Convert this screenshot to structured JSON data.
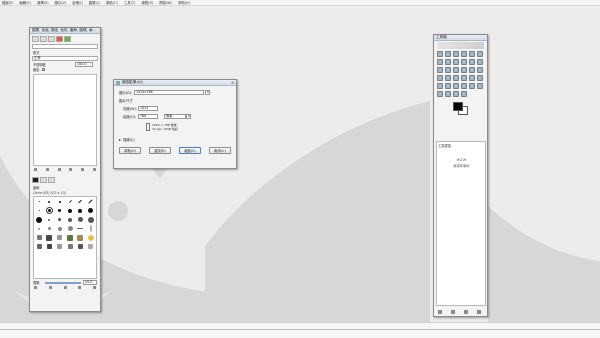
{
  "menubar": {
    "items": [
      "檔案(F)",
      "編輯(E)",
      "選擇(S)",
      "顯示(V)",
      "影像(I)",
      "圖層(L)",
      "顏色(C)",
      "工具(T)",
      "濾鏡(R)",
      "視窗(W)",
      "求助(H)"
    ]
  },
  "left_dock": {
    "tab_title": "圖層, 色版, 路徑, 色彩, 筆刷, 圖樣, 漸...",
    "mode_label": "模式",
    "mode_value": "正常",
    "opacity_label": "不透明度",
    "opacity_value": "100.0",
    "lock_label": "鎖定:",
    "brush_tab_label": "筆刷",
    "brush_name": "Circle (03) (13 × 13)",
    "spacing_label": "間隔",
    "spacing_value": "20.0"
  },
  "dialog": {
    "title": "縮放影像大小",
    "image_label": "顯示(D):",
    "image_value": "1024x768",
    "section_title": "圖片尺寸",
    "width_label": "寬度(W):",
    "width_value": "1024",
    "height_label": "高度(H):",
    "height_value": "768",
    "unit_value": "像素",
    "info_line1": "1024 × 768 像素",
    "info_line2": "72 ppi - RGB 色彩",
    "quality_label": "插補(Q)",
    "buttons": {
      "help": "求助(H)",
      "reset": "重設(R)",
      "scale": "縮放(S)",
      "cancel": "取消(C)"
    }
  },
  "toolbox": {
    "title": "工具箱",
    "options_title": "工具選項",
    "options_text_line1": "未工具",
    "options_text_line2": "是否有選項"
  },
  "colors": {
    "foreground": "#000000",
    "background": "#ffffff",
    "accent": "#4b7fbf"
  }
}
